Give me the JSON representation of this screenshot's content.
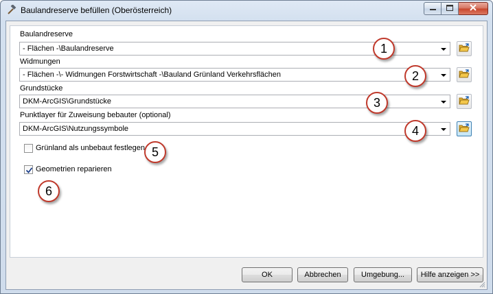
{
  "window": {
    "title": "Baulandreserve befüllen (Oberösterreich)",
    "app_icon": "hammer-icon",
    "controls": [
      "minimize-icon",
      "maximize-icon",
      "close-icon"
    ]
  },
  "fields": [
    {
      "label": "Baulandreserve",
      "value": "- Flächen -\\Baulandreserve",
      "callout": "1"
    },
    {
      "label": "Widmungen",
      "value": "- Flächen -\\- Widmungen Forstwirtschaft -\\Bauland Grünland Verkehrsflächen",
      "callout": "2"
    },
    {
      "label": "Grundstücke",
      "value": "DKM-ArcGIS\\Grundstücke",
      "callout": "3"
    },
    {
      "label": "Punktlayer für Zuweisung bebauter (optional)",
      "value": "DKM-ArcGIS\\Nutzungssymbole",
      "callout": "4"
    }
  ],
  "checkboxes": [
    {
      "label": "Grünland als unbebaut festlegen",
      "checked": false,
      "callout": "5"
    },
    {
      "label": "Geometrien reparieren",
      "checked": true,
      "callout": "6"
    }
  ],
  "buttons": {
    "ok": "OK",
    "cancel": "Abbrechen",
    "environment": "Umgebung...",
    "help": "Hilfe anzeigen >>"
  },
  "colors": {
    "callout_border": "#c0392b",
    "folder_yellow": "#f3c74b",
    "close_red": "#c8452c"
  }
}
